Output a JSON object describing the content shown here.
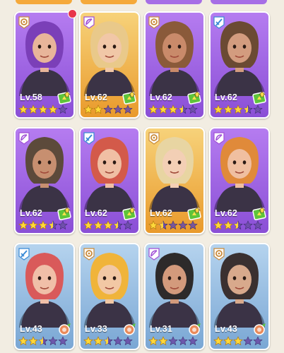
{
  "cards": [
    {
      "level": "Lv.58",
      "rarity": "purple",
      "class_icon": "gear-icon",
      "badge": "upgrade-badge-icon",
      "stars": [
        1,
        1,
        1,
        1,
        0
      ],
      "hair": "#7b3fb8",
      "skin": "#e8b59a",
      "notify": true
    },
    {
      "level": "Lv.62",
      "rarity": "gold",
      "class_icon": "bow-icon",
      "badge": "upgrade-badge-icon",
      "stars": [
        1,
        1,
        0,
        0,
        0
      ],
      "hair": "#e9c98a",
      "skin": "#f1c7a7",
      "notify": false
    },
    {
      "level": "Lv.62",
      "rarity": "purple",
      "class_icon": "gear-icon",
      "badge": "upgrade-badge-icon",
      "stars": [
        1,
        1,
        1,
        0.5,
        0
      ],
      "hair": "#8a5a3a",
      "skin": "#c98a6a",
      "notify": false
    },
    {
      "level": "Lv.62",
      "rarity": "purple",
      "class_icon": "sword-icon",
      "badge": "upgrade-badge-icon",
      "stars": [
        1,
        1,
        1,
        0.5,
        0
      ],
      "hair": "#6b4a33",
      "skin": "#d39c7f",
      "notify": false
    },
    {
      "level": "Lv.62",
      "rarity": "purple",
      "class_icon": "bow-icon",
      "badge": "upgrade-badge-icon",
      "stars": [
        1,
        1,
        1,
        0.5,
        0
      ],
      "hair": "#5c4a3b",
      "skin": "#c78f70",
      "notify": false
    },
    {
      "level": "Lv.62",
      "rarity": "purple",
      "class_icon": "sword-icon",
      "badge": "upgrade-badge-icon",
      "stars": [
        1,
        1,
        1,
        0.5,
        0
      ],
      "hair": "#d35a4a",
      "skin": "#f0bfa4",
      "notify": false
    },
    {
      "level": "Lv.62",
      "rarity": "gold",
      "class_icon": "gear-icon",
      "badge": "upgrade-badge-icon",
      "stars": [
        1,
        0.5,
        0,
        0,
        0
      ],
      "hair": "#e8d5a2",
      "skin": "#f3cfb5",
      "notify": false
    },
    {
      "level": "Lv.62",
      "rarity": "purple",
      "class_icon": "bow-icon",
      "badge": "upgrade-badge-icon",
      "stars": [
        1,
        1,
        0.5,
        0,
        0
      ],
      "hair": "#e08a3a",
      "skin": "#f0bfa0",
      "notify": false
    },
    {
      "level": "Lv.43",
      "rarity": "blue",
      "class_icon": "sword-icon",
      "badge": "meat-badge-icon",
      "stars": [
        1,
        1,
        0.5,
        0,
        0
      ],
      "hair": "#d95a5a",
      "skin": "#f0bfa8",
      "notify": false
    },
    {
      "level": "Lv.33",
      "rarity": "blue",
      "class_icon": "gear-icon",
      "badge": "meat-badge-icon",
      "stars": [
        1,
        1,
        0.5,
        0,
        0
      ],
      "hair": "#f0b43a",
      "skin": "#f2c8a4",
      "notify": false
    },
    {
      "level": "Lv.31",
      "rarity": "blue",
      "class_icon": "bow-icon",
      "badge": "meat-badge-icon",
      "stars": [
        1,
        1,
        0,
        0,
        0
      ],
      "hair": "#2d2a2a",
      "skin": "#d39a7c",
      "notify": false
    },
    {
      "level": "Lv.43",
      "rarity": "blue",
      "class_icon": "gear-icon",
      "badge": "meat-badge-icon",
      "stars": [
        1,
        1,
        1,
        0,
        0
      ],
      "hair": "#3a3030",
      "skin": "#d8a98c",
      "notify": false
    }
  ],
  "colors": {
    "star_on": "#ffd83a",
    "star_off": "#6c4fa8",
    "badge_green": "#5ec43a",
    "meat": "#e98a5a"
  }
}
